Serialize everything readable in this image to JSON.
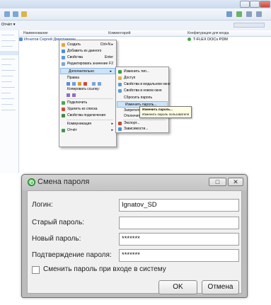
{
  "explorer": {
    "toolbar_left_text": "Отчёт ▾",
    "columns": [
      "Наименование",
      "Комментарий",
      "Конфигурация для входа"
    ],
    "row": {
      "name": "Игнатов Сергей Дмитриевич",
      "config": "T-FLEX DOCs PDM"
    }
  },
  "context_menu": {
    "items": [
      {
        "label": "Создать",
        "shortcut": "Ctrl+N ▸",
        "icon": "create-icon",
        "color": "#e8a33a"
      },
      {
        "label": "Добавить из данного",
        "shortcut": "",
        "icon": "add-from-icon",
        "color": "#4a8fd1"
      },
      {
        "label": "Свойства",
        "shortcut": "Enter",
        "icon": "properties-icon",
        "color": "#5b9bd5"
      },
      {
        "label": "Редактировать значение",
        "shortcut": "F2",
        "icon": "edit-value-icon",
        "color": "#7aa6d8"
      },
      {
        "label": "Дополнительно",
        "shortcut": "▸",
        "icon": "more-icon",
        "color": "#9a9a9a",
        "highlighted": true
      },
      {
        "label": "Правка",
        "shortcut": "",
        "icon": "",
        "color": ""
      },
      {
        "label": "",
        "shortcut": "",
        "icon": "edit-toolbar-icons",
        "color": "#5d8fcf"
      },
      {
        "label": "Копировать ссылку:",
        "shortcut": "",
        "icon": "",
        "color": ""
      },
      {
        "label": "",
        "shortcut": "",
        "icon": "link-icons",
        "color": "#8b6fc6"
      },
      {
        "label": "Подключить",
        "shortcut": "",
        "icon": "connect-icon",
        "color": "#4aa84a"
      },
      {
        "label": "Удалить из списка",
        "shortcut": "",
        "icon": "remove-icon",
        "color": "#d04b3c"
      },
      {
        "label": "Свойства подключения",
        "shortcut": "",
        "icon": "connection-properties-icon",
        "color": "#3f8d3f"
      },
      {
        "label": "Коммуникация",
        "shortcut": "▸",
        "icon": "",
        "color": ""
      },
      {
        "label": "Отчёт",
        "shortcut": "▸",
        "icon": "report-icon",
        "color": "#3b9a4a"
      }
    ]
  },
  "submenu": {
    "items": [
      {
        "label": "Изменить тип...",
        "icon": "change-type-icon",
        "color": "#3b9a4a"
      },
      {
        "label": "Доступ",
        "icon": "access-icon",
        "color": "#e2b23a"
      },
      {
        "label": "Свойства в модальном окне",
        "icon": "modal-props-icon",
        "color": "#5b9bd5"
      },
      {
        "label": "Свойства в новом окне",
        "icon": "new-window-props-icon",
        "color": "#5b9bd5"
      },
      {
        "label": "Сбросить пароль",
        "icon": "",
        "color": ""
      },
      {
        "label": "Изменить пароль...",
        "icon": "",
        "color": "",
        "highlighted": true
      },
      {
        "label": "Запретить вх",
        "icon": "",
        "color": ""
      },
      {
        "label": "Отключить",
        "icon": "",
        "color": ""
      },
      {
        "label": "Экспорт...",
        "icon": "export-icon",
        "color": "#c44a3a"
      },
      {
        "label": "Зависимости...",
        "icon": "dependencies-icon",
        "color": "#4a8fd1"
      }
    ]
  },
  "tooltip": {
    "title": "Изменить пароль...",
    "text": "Изменить пароль пользователя"
  },
  "dialog": {
    "title": "Смена пароля",
    "fields": {
      "login": {
        "label": "Логин:",
        "value": "Ignatov_SD"
      },
      "old_password": {
        "label": "Старый пароль:",
        "value": ""
      },
      "new_password": {
        "label": "Новый пароль:",
        "value": "*******"
      },
      "confirm_password": {
        "label": "Подтверждение пароля:",
        "value": "*******"
      }
    },
    "checkbox_label": "Сменить пароль при входе в систему",
    "checkbox_checked": false,
    "ok_label": "OK",
    "cancel_label": "Отмена",
    "maximize_glyph": "□",
    "close_glyph": "✕"
  }
}
